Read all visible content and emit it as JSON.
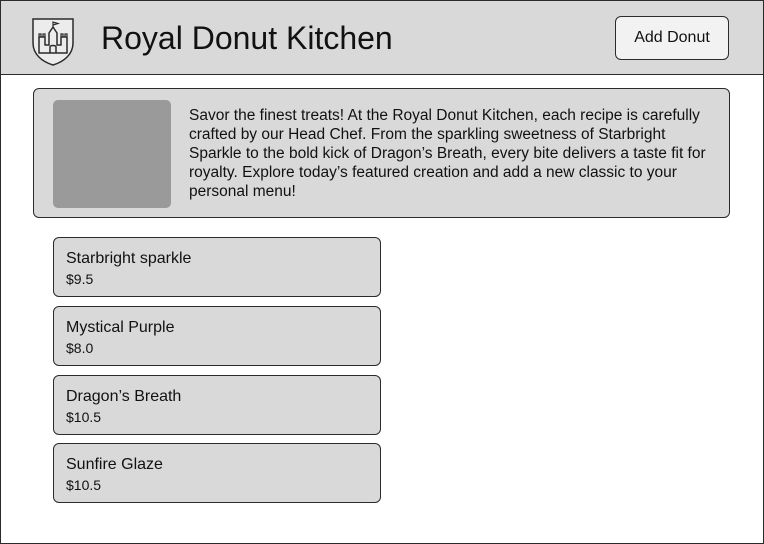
{
  "header": {
    "title": "Royal Donut Kitchen",
    "logo_icon": "castle-shield-icon",
    "add_button_label": "Add Donut"
  },
  "featured": {
    "description": "Savor the finest treats! At the Royal Donut Kitchen, each recipe is carefully crafted by our Head Chef. From the sparkling sweetness of Starbright Sparkle to the bold kick of Dragon’s Breath, every bite delivers a taste fit for royalty. Explore today’s featured creation and add a new classic to your personal menu!"
  },
  "donuts": [
    {
      "name": "Starbright sparkle",
      "price": "$9.5"
    },
    {
      "name": "Mystical Purple",
      "price": "$8.0"
    },
    {
      "name": "Dragon’s Breath",
      "price": "$10.5"
    },
    {
      "name": "Sunfire Glaze",
      "price": "$10.5"
    }
  ],
  "colors": {
    "header_bg": "#d9d9d9",
    "card_bg": "#d9d9d9",
    "image_placeholder": "#9a9a9a",
    "border": "#2b2b2b"
  }
}
